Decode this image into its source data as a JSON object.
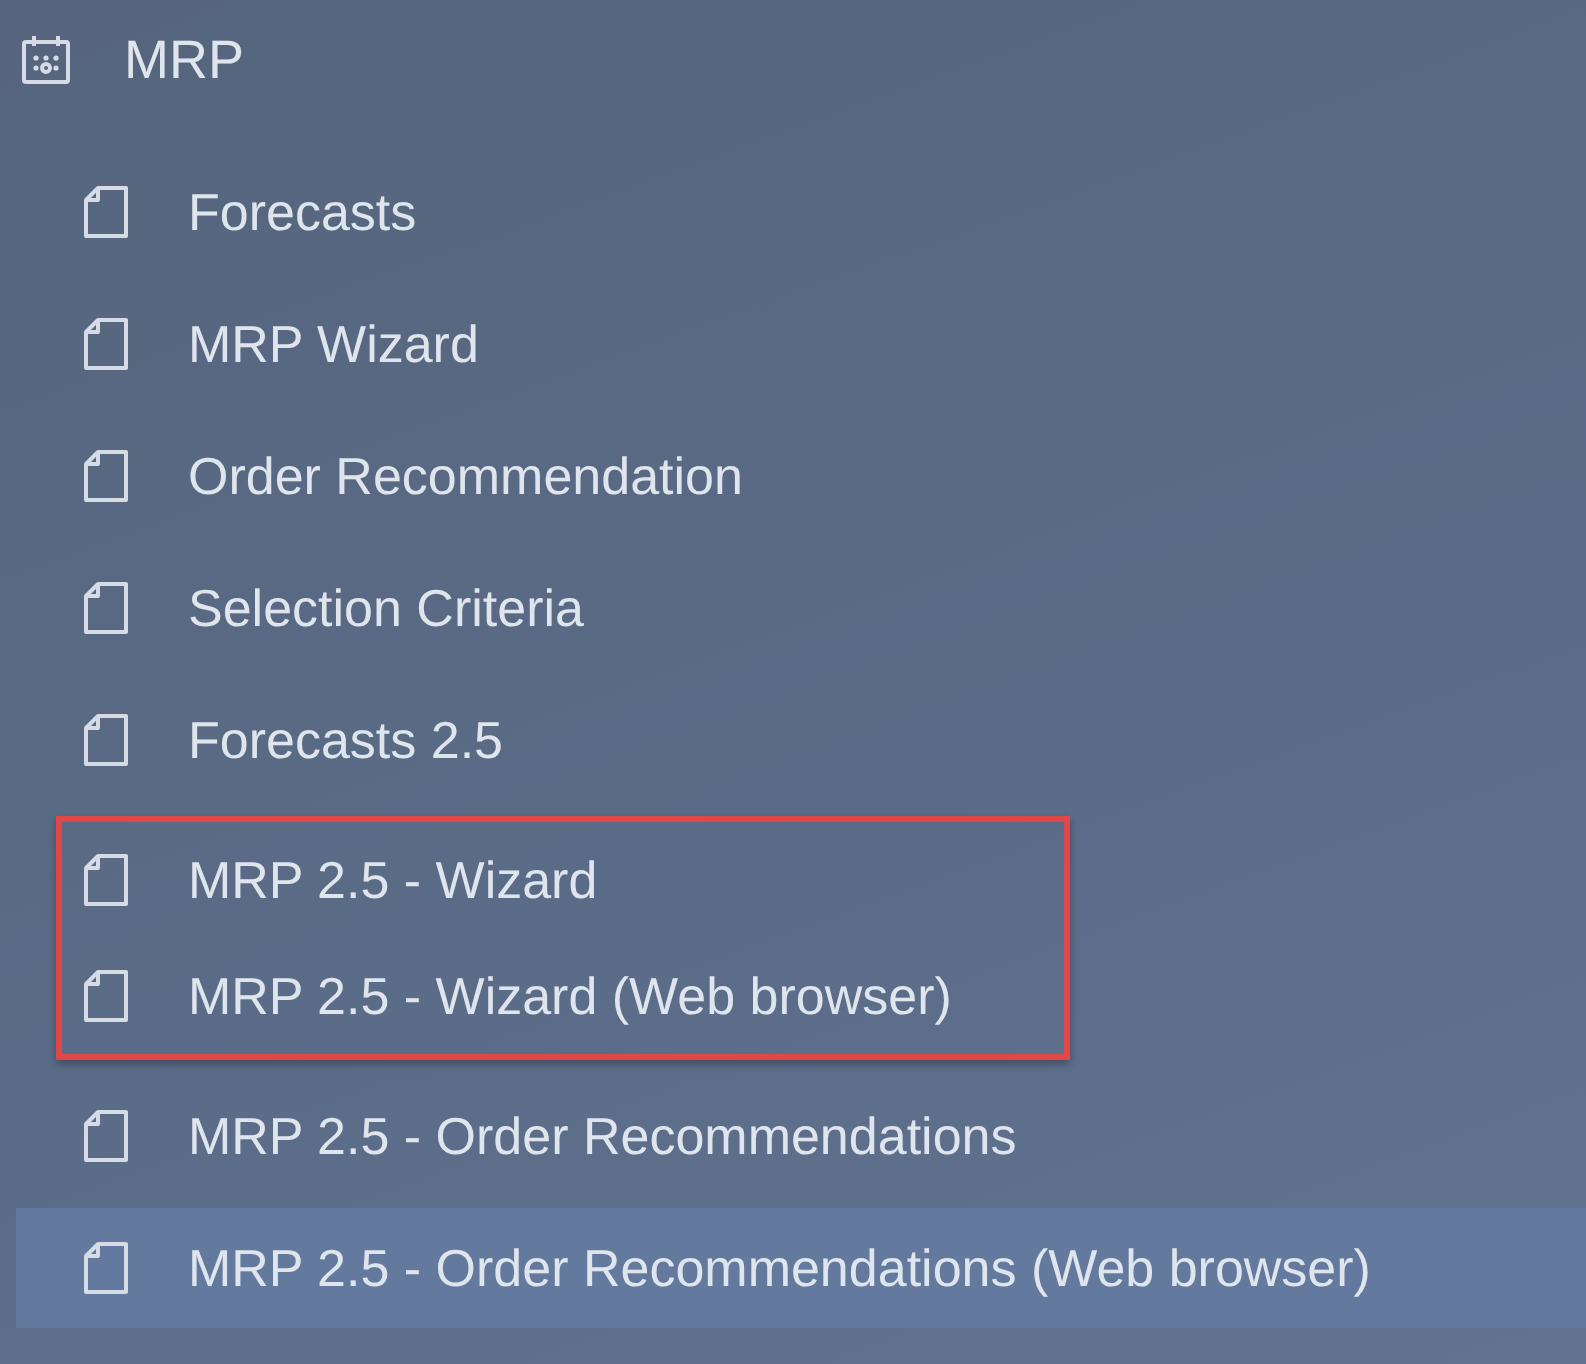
{
  "section": {
    "title": "MRP"
  },
  "items": [
    {
      "label": "Forecasts",
      "selected": false,
      "annotated": false
    },
    {
      "label": "MRP Wizard",
      "selected": false,
      "annotated": false
    },
    {
      "label": "Order Recommendation",
      "selected": false,
      "annotated": false
    },
    {
      "label": "Selection Criteria",
      "selected": false,
      "annotated": false
    },
    {
      "label": "Forecasts 2.5",
      "selected": false,
      "annotated": false
    },
    {
      "label": "MRP 2.5 - Wizard",
      "selected": false,
      "annotated": true
    },
    {
      "label": "MRP 2.5 - Wizard (Web browser)",
      "selected": false,
      "annotated": true
    },
    {
      "label": "MRP 2.5 - Order Recommendations",
      "selected": false,
      "annotated": false
    },
    {
      "label": "MRP 2.5 - Order Recommendations (Web browser)",
      "selected": true,
      "annotated": false
    }
  ]
}
